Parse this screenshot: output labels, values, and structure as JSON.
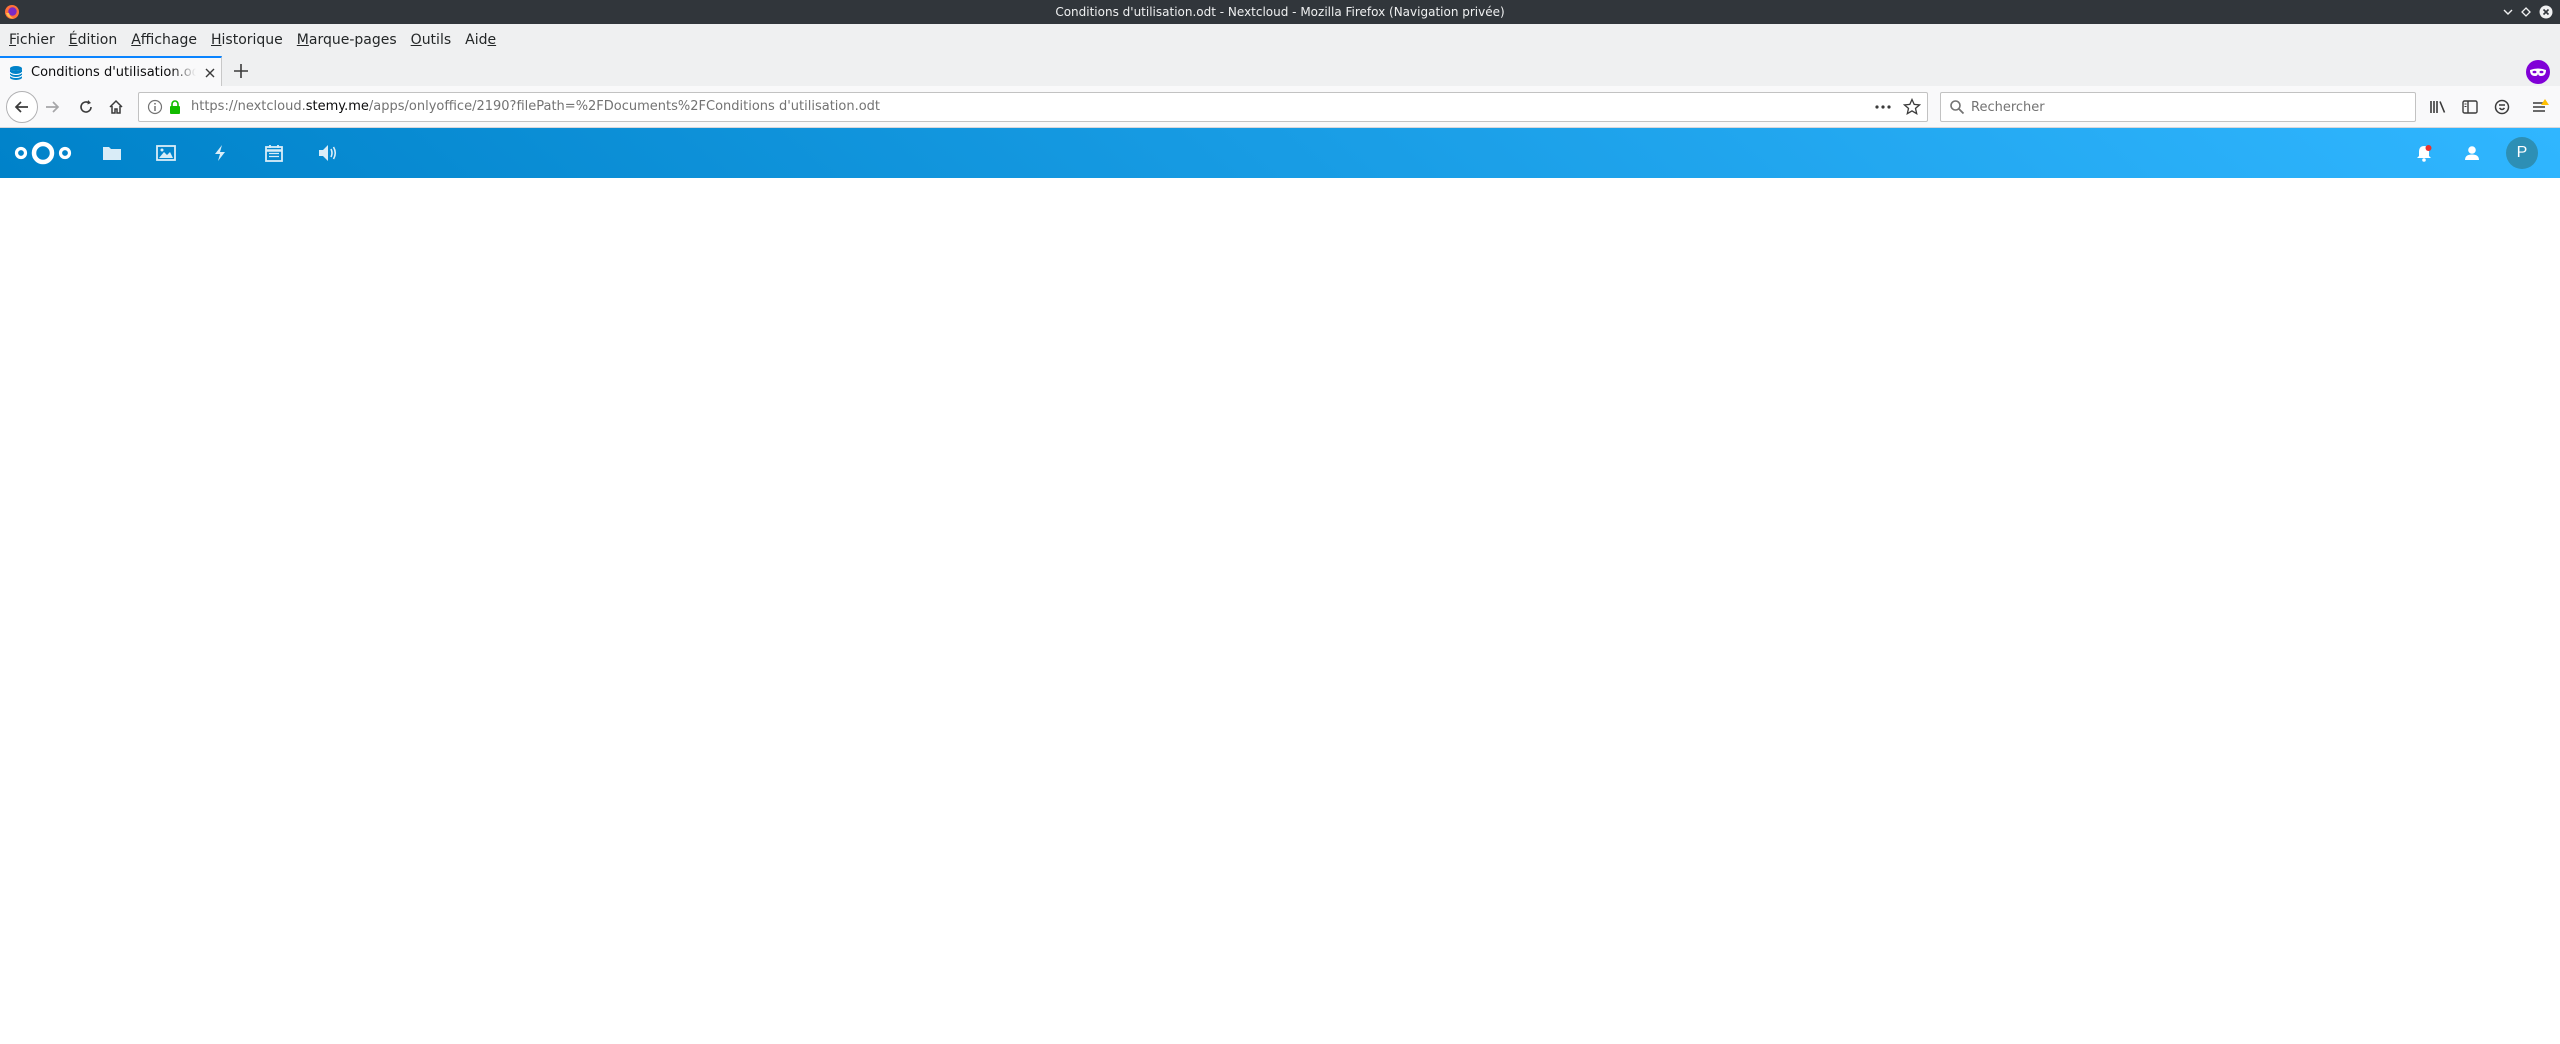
{
  "window": {
    "title": "Conditions d'utilisation.odt - Nextcloud - Mozilla Firefox (Navigation privée)"
  },
  "menubar": {
    "items": [
      {
        "label": "Fichier",
        "mnemonic_index": 0
      },
      {
        "label": "Édition",
        "mnemonic_index": 0
      },
      {
        "label": "Affichage",
        "mnemonic_index": 0
      },
      {
        "label": "Historique",
        "mnemonic_index": 0
      },
      {
        "label": "Marque-pages",
        "mnemonic_index": 0
      },
      {
        "label": "Outils",
        "mnemonic_index": 0
      },
      {
        "label": "Aide",
        "mnemonic_index": 3
      }
    ]
  },
  "tabs": [
    {
      "title": "Conditions d'utilisation.odt",
      "active": true,
      "favicon": "nextcloud-database-icon"
    }
  ],
  "navbar": {
    "url_prefix": "https://nextcloud.",
    "url_host": "stemy.me",
    "url_path": "/apps/onlyoffice/2190?filePath=%2FDocuments%2FConditions d'utilisation.odt",
    "search_placeholder": "Rechercher"
  },
  "nextcloud": {
    "apps": [
      {
        "name": "files-icon"
      },
      {
        "name": "gallery-icon"
      },
      {
        "name": "activity-icon"
      },
      {
        "name": "calendar-icon"
      },
      {
        "name": "audio-player-icon"
      }
    ],
    "avatar_letter": "P"
  },
  "colors": {
    "header_gradient_start": "#0082c9",
    "header_gradient_end": "#30b6ff",
    "private_badge": "#8000d7",
    "avatar": "#2d8fb5"
  }
}
